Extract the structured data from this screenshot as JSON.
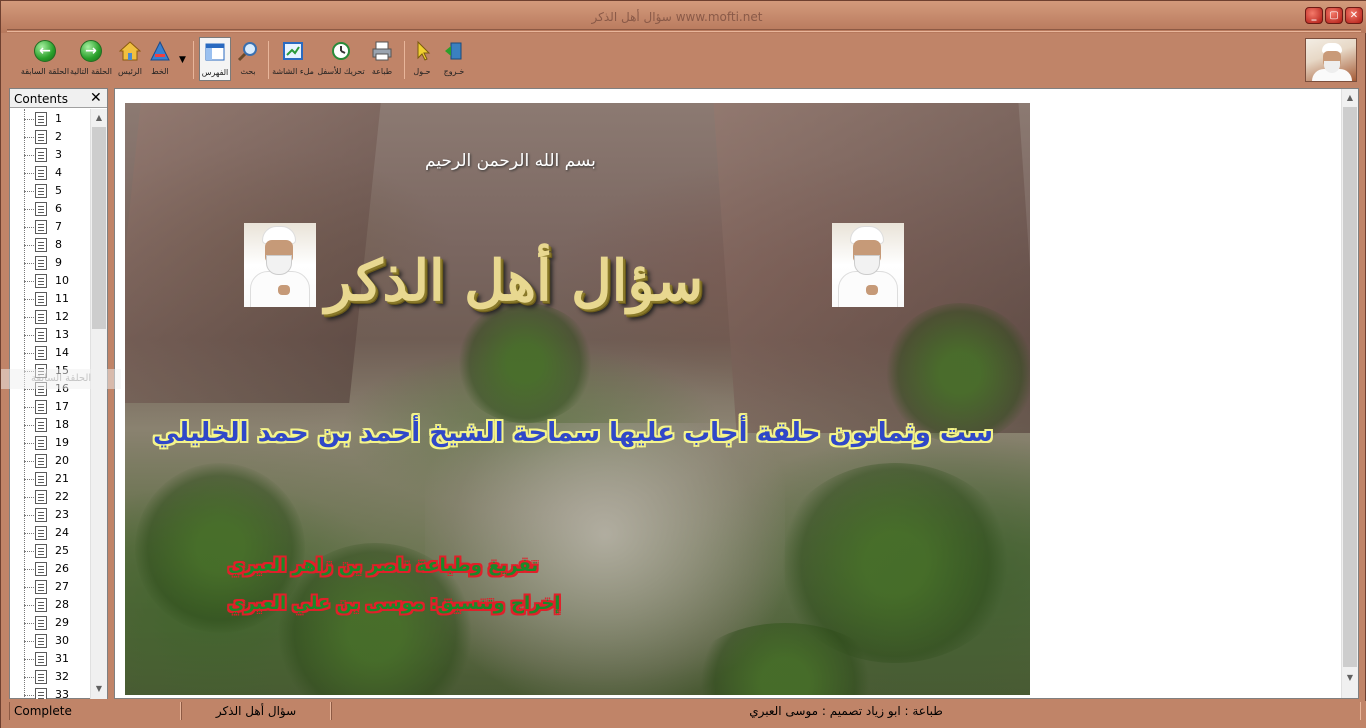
{
  "window": {
    "title": "سؤال أهل الذكر",
    "url": "www.mofti.net",
    "min_label": "_",
    "max_label": "▢",
    "close_label": "✕"
  },
  "toolbar": {
    "prev_label": "الحلقة السابقة",
    "next_label": "الحلقة التالية",
    "home_label": "الرئيس",
    "font_label": "الخط",
    "index_label": "الفهرس",
    "search_label": "بحث",
    "fullscreen_label": "ملء الشاشة",
    "down_label": "تحريك للأسفل",
    "print_label": "طباعة",
    "about_label": "حـول",
    "exit_label": "خـروج"
  },
  "contents": {
    "title": "Contents",
    "close": "✕",
    "items": [
      "1",
      "2",
      "3",
      "4",
      "5",
      "6",
      "7",
      "8",
      "9",
      "10",
      "11",
      "12",
      "13",
      "14",
      "15",
      "16",
      "17",
      "18",
      "19",
      "20",
      "21",
      "22",
      "23",
      "24",
      "25",
      "26",
      "27",
      "28",
      "29",
      "30",
      "31",
      "32",
      "33"
    ]
  },
  "hero": {
    "bismillah": "بسم الله الرحمن الرحيم",
    "title": "سؤال أهل الذكر",
    "subtitle": "ست وثمانون حلقة أجاب عليها سماحة الشيخ أحمد بن حمد الخليلي",
    "credit1": "تفريغ وطباعة ناصر بن زاهر العبري",
    "credit2": "إخراج وتنسيق: موسى بن علي العبري",
    "ghost_tip": "الحلقة السابقة"
  },
  "status": {
    "state": "Complete",
    "book": "سؤال أهل الذكر",
    "credits": "طباعة : ابو زياد    تصميم : موسى العبري"
  }
}
